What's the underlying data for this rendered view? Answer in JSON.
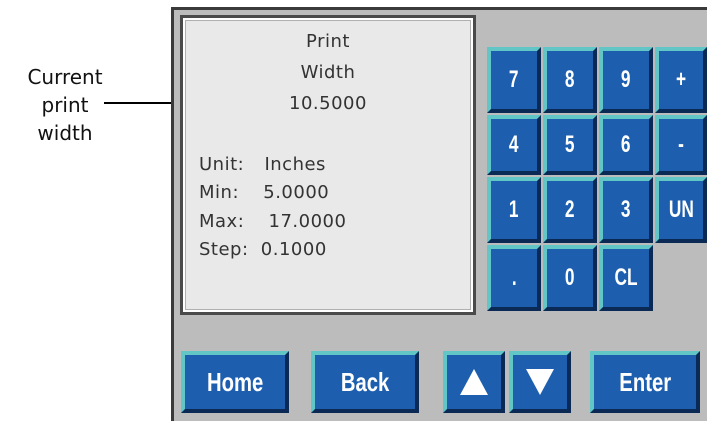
{
  "callout": {
    "lines": [
      "Current",
      "print",
      "width"
    ]
  },
  "display": {
    "title_line1": "Print",
    "title_line2": "Width",
    "current_value": "10.5000",
    "unit_label": "Unit:",
    "unit_value": "Inches",
    "min_label": "Min:",
    "min_value": "5.0000",
    "max_label": "Max:",
    "max_value": "17.0000",
    "step_label": "Step:",
    "step_value": "0.1000"
  },
  "keypad": {
    "k7": "7",
    "k8": "8",
    "k9": "9",
    "plus": "+",
    "k4": "4",
    "k5": "5",
    "k6": "6",
    "minus": "-",
    "k1": "1",
    "k2": "2",
    "k3": "3",
    "un": "UN",
    "dot": ".",
    "k0": "0",
    "cl": "CL"
  },
  "bottom": {
    "home": "Home",
    "back": "Back",
    "up_icon": "up-arrow",
    "down_icon": "down-arrow",
    "enter": "Enter"
  },
  "colors": {
    "key_face": "#1d5fae",
    "key_highlight": "#63c6c6",
    "panel_bg": "#bcbcbc",
    "display_bg": "#e9e9e9"
  }
}
